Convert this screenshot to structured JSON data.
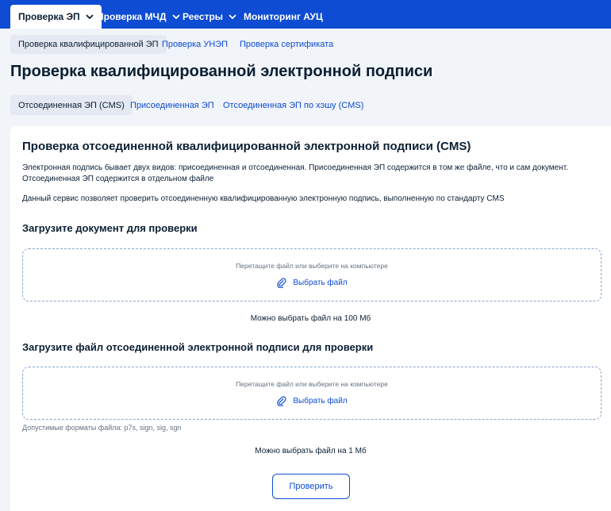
{
  "topnav": {
    "items": [
      {
        "label": "Проверка ЭП"
      },
      {
        "label": "Проверка МЧД"
      },
      {
        "label": "Реестры"
      },
      {
        "label": "Мониторинг АУЦ"
      }
    ]
  },
  "subtabs": [
    {
      "label": "Проверка квалифицированной ЭП"
    },
    {
      "label": "Проверка УНЭП"
    },
    {
      "label": "Проверка сертификата"
    }
  ],
  "page": {
    "title": "Проверка квалифицированной электронной подписи"
  },
  "ep_tabs": [
    {
      "label": "Отсоединенная ЭП (CMS)"
    },
    {
      "label": "Присоединенная ЭП"
    },
    {
      "label": "Отсоединенная ЭП по хэшу (CMS)"
    }
  ],
  "card": {
    "title": "Проверка отсоединенной квалифицированной электронной подписи (CMS)",
    "desc1": "Электронная подпись бывает двух видов: присоединенная и отсоединенная. Присоединенная ЭП содержится в том же файле, что и сам документ. Отсоединенная ЭП содержится в отдельном файле",
    "desc2": "Данный сервис позволяет проверить отсоединенную квалифицированную электронную подпись, выполненную по стандарту CMS",
    "document": {
      "title": "Загрузите документ для проверки",
      "hint": "Перетащите файл или выберите на компьютере",
      "button": "Выбрать файл",
      "limit": "Можно выбрать файл на 100 Мб"
    },
    "signature": {
      "title": "Загрузите файл отсоединенной электронной подписи для проверки",
      "hint": "Перетащите файл или выберите на компьютере",
      "button": "Выбрать файл",
      "formats": "Допустимые форматы файла: p7s, sign, sig, sgn",
      "limit": "Можно выбрать файл на 1 Мб"
    },
    "verify_button": "Проверить"
  }
}
